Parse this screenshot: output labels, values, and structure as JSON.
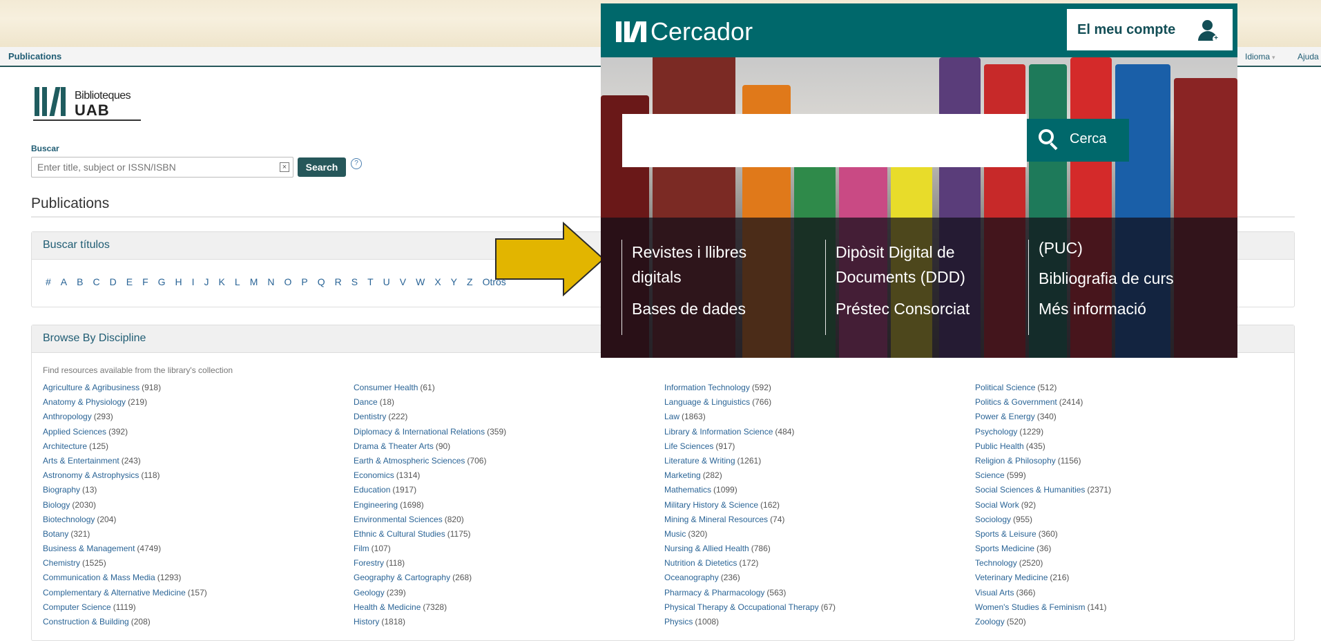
{
  "navbar": {
    "brand": "Publications",
    "language": "Idioma",
    "help": "Ajuda"
  },
  "logo": {
    "line1": "Biblioteques",
    "line2": "UAB"
  },
  "search": {
    "label": "Buscar",
    "placeholder": "Enter title, subject or ISSN/ISBN",
    "clear": "×",
    "button": "Search",
    "help": "?"
  },
  "page_title": "Publications",
  "browse_titles": {
    "heading": "Buscar títulos",
    "letters": [
      "#",
      "A",
      "B",
      "C",
      "D",
      "E",
      "F",
      "G",
      "H",
      "I",
      "J",
      "K",
      "L",
      "M",
      "N",
      "O",
      "P",
      "Q",
      "R",
      "S",
      "T",
      "U",
      "V",
      "W",
      "X",
      "Y",
      "Z",
      "Otros"
    ]
  },
  "discipline": {
    "heading": "Browse By Discipline",
    "intro": "Find resources available from the library's collection",
    "columns": [
      [
        {
          "name": "Agriculture & Agribusiness",
          "count": "(918)"
        },
        {
          "name": "Anatomy & Physiology",
          "count": "(219)"
        },
        {
          "name": "Anthropology",
          "count": "(293)"
        },
        {
          "name": "Applied Sciences",
          "count": "(392)"
        },
        {
          "name": "Architecture",
          "count": "(125)"
        },
        {
          "name": "Arts & Entertainment",
          "count": "(243)"
        },
        {
          "name": "Astronomy & Astrophysics",
          "count": "(118)"
        },
        {
          "name": "Biography",
          "count": "(13)"
        },
        {
          "name": "Biology",
          "count": "(2030)"
        },
        {
          "name": "Biotechnology",
          "count": "(204)"
        },
        {
          "name": "Botany",
          "count": "(321)"
        },
        {
          "name": "Business & Management",
          "count": "(4749)"
        },
        {
          "name": "Chemistry",
          "count": "(1525)"
        },
        {
          "name": "Communication & Mass Media",
          "count": "(1293)"
        },
        {
          "name": "Complementary & Alternative Medicine",
          "count": "(157)"
        },
        {
          "name": "Computer Science",
          "count": "(1119)"
        },
        {
          "name": "Construction & Building",
          "count": "(208)"
        }
      ],
      [
        {
          "name": "Consumer Health",
          "count": "(61)"
        },
        {
          "name": "Dance",
          "count": "(18)"
        },
        {
          "name": "Dentistry",
          "count": "(222)"
        },
        {
          "name": "Diplomacy & International Relations",
          "count": "(359)"
        },
        {
          "name": "Drama & Theater Arts",
          "count": "(90)"
        },
        {
          "name": "Earth & Atmospheric Sciences",
          "count": "(706)"
        },
        {
          "name": "Economics",
          "count": "(1314)"
        },
        {
          "name": "Education",
          "count": "(1917)"
        },
        {
          "name": "Engineering",
          "count": "(1698)"
        },
        {
          "name": "Environmental Sciences",
          "count": "(820)"
        },
        {
          "name": "Ethnic & Cultural Studies",
          "count": "(1175)"
        },
        {
          "name": "Film",
          "count": "(107)"
        },
        {
          "name": "Forestry",
          "count": "(118)"
        },
        {
          "name": "Geography & Cartography",
          "count": "(268)"
        },
        {
          "name": "Geology",
          "count": "(239)"
        },
        {
          "name": "Health & Medicine",
          "count": "(7328)"
        },
        {
          "name": "History",
          "count": "(1818)"
        }
      ],
      [
        {
          "name": "Information Technology",
          "count": "(592)"
        },
        {
          "name": "Language & Linguistics",
          "count": "(766)"
        },
        {
          "name": "Law",
          "count": "(1863)"
        },
        {
          "name": "Library & Information Science",
          "count": "(484)"
        },
        {
          "name": "Life Sciences",
          "count": "(917)"
        },
        {
          "name": "Literature & Writing",
          "count": "(1261)"
        },
        {
          "name": "Marketing",
          "count": "(282)"
        },
        {
          "name": "Mathematics",
          "count": "(1099)"
        },
        {
          "name": "Military History & Science",
          "count": "(162)"
        },
        {
          "name": "Mining & Mineral Resources",
          "count": "(74)"
        },
        {
          "name": "Music",
          "count": "(320)"
        },
        {
          "name": "Nursing & Allied Health",
          "count": "(786)"
        },
        {
          "name": "Nutrition & Dietetics",
          "count": "(172)"
        },
        {
          "name": "Oceanography",
          "count": "(236)"
        },
        {
          "name": "Pharmacy & Pharmacology",
          "count": "(563)"
        },
        {
          "name": "Physical Therapy & Occupational Therapy",
          "count": "(67)"
        },
        {
          "name": "Physics",
          "count": "(1008)"
        }
      ],
      [
        {
          "name": "Political Science",
          "count": "(512)"
        },
        {
          "name": "Politics & Government",
          "count": "(2414)"
        },
        {
          "name": "Power & Energy",
          "count": "(340)"
        },
        {
          "name": "Psychology",
          "count": "(1229)"
        },
        {
          "name": "Public Health",
          "count": "(435)"
        },
        {
          "name": "Religion & Philosophy",
          "count": "(1156)"
        },
        {
          "name": "Science",
          "count": "(599)"
        },
        {
          "name": "Social Sciences & Humanities",
          "count": "(2371)"
        },
        {
          "name": "Social Work",
          "count": "(92)"
        },
        {
          "name": "Sociology",
          "count": "(955)"
        },
        {
          "name": "Sports & Leisure",
          "count": "(360)"
        },
        {
          "name": "Sports Medicine",
          "count": "(36)"
        },
        {
          "name": "Technology",
          "count": "(2520)"
        },
        {
          "name": "Veterinary Medicine",
          "count": "(216)"
        },
        {
          "name": "Visual Arts",
          "count": "(366)"
        },
        {
          "name": "Women's Studies & Feminism",
          "count": "(141)"
        },
        {
          "name": "Zoology",
          "count": "(520)"
        }
      ]
    ]
  },
  "overlay": {
    "title": "Cercador",
    "account": "El meu compte",
    "search_button": "Cerca",
    "col1": {
      "a": "Revistes i llibres",
      "b": "digitals",
      "c": "Bases de dades"
    },
    "col2": {
      "a": "Dipòsit Digital de",
      "b": "Documents (DDD)",
      "c": "Préstec Consorciat"
    },
    "col3": {
      "a": "(PUC)",
      "b": "Bibliografia de curs",
      "c": "Més informació"
    }
  },
  "colors": {
    "accent": "#00686b",
    "link": "#2a6496",
    "arrow": "#e2b500"
  }
}
